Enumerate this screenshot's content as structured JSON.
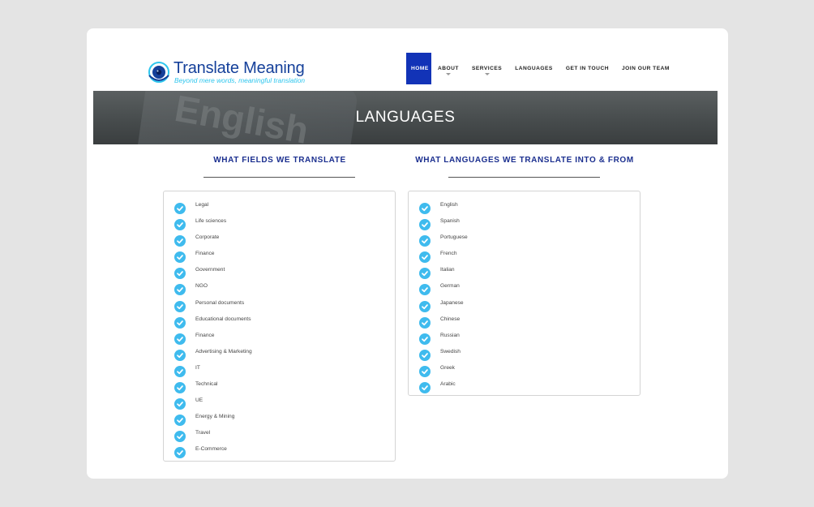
{
  "header": {
    "logo_title": "Translate Meaning",
    "logo_tagline": "Beyond mere words, meaningful translation",
    "nav": [
      {
        "label": "HOME",
        "active": true,
        "dropdown": false
      },
      {
        "label": "ABOUT",
        "active": false,
        "dropdown": true
      },
      {
        "label": "SERVICES",
        "active": false,
        "dropdown": true
      },
      {
        "label": "LANGUAGES",
        "active": false,
        "dropdown": false
      },
      {
        "label": "GET IN TOUCH",
        "active": false,
        "dropdown": false
      },
      {
        "label": "JOIN OUR TEAM",
        "active": false,
        "dropdown": false
      }
    ]
  },
  "banner": {
    "title": "LANGUAGES",
    "watermark": "English"
  },
  "fields": {
    "heading": "WHAT FIELDS WE TRANSLATE",
    "items": [
      "Legal",
      "Life sciences",
      "Corporate",
      "Finance",
      "Government",
      "NGO",
      "Personal documents",
      "Educational documents",
      "Finance",
      "Advertising & Marketing",
      "IT",
      "Technical",
      "UE",
      "Energy & Mining",
      "Travel",
      "E-Commerce"
    ]
  },
  "languages": {
    "heading": "WHAT LANGUAGES WE TRANSLATE INTO & FROM",
    "items": [
      "English",
      "Spanish",
      "Portuguese",
      "French",
      "Italian",
      "German",
      "Japanese",
      "Chinese",
      "Russian",
      "Swedish",
      "Greek",
      "Arabic"
    ]
  },
  "colors": {
    "brand_blue": "#15409a",
    "nav_active": "#1233b7",
    "accent_cyan": "#2ec6ee",
    "check": "#3fbbee",
    "heading": "#1b2f8f"
  },
  "icons": {
    "logo": "globe-eye-icon",
    "list_marker": "check-circle-icon",
    "nav_dropdown": "caret-down-icon"
  }
}
